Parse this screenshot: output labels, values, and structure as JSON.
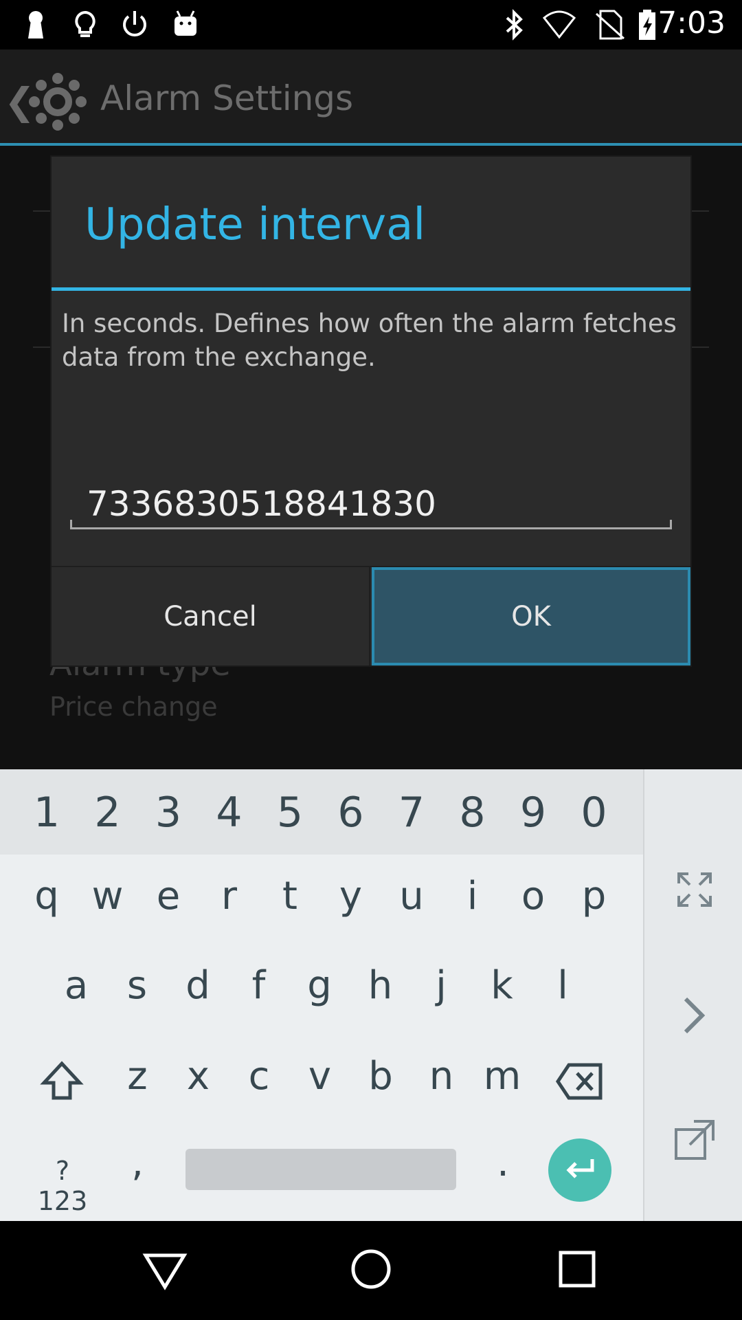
{
  "status_bar": {
    "time": "7:03",
    "left_icons": [
      "keyhole-icon",
      "lightbulb-icon",
      "power-icon",
      "android-icon"
    ],
    "right_icons": [
      "bluetooth-icon",
      "wifi-off-icon",
      "no-sim-icon",
      "battery-charging-icon"
    ]
  },
  "app_bar": {
    "title": "Alarm Settings"
  },
  "background_prefs": {
    "alarm_type_title": "Alarm type",
    "alarm_type_summary": "Price change"
  },
  "dialog": {
    "title": "Update interval",
    "message": "In seconds. Defines how often the alarm fetches data from the exchange.",
    "input_value": "7336830518841830",
    "cancel_label": "Cancel",
    "ok_label": "OK"
  },
  "keyboard": {
    "number_row": [
      "1",
      "2",
      "3",
      "4",
      "5",
      "6",
      "7",
      "8",
      "9",
      "0"
    ],
    "row1": [
      "q",
      "w",
      "e",
      "r",
      "t",
      "y",
      "u",
      "i",
      "o",
      "p"
    ],
    "row2": [
      "a",
      "s",
      "d",
      "f",
      "g",
      "h",
      "j",
      "k",
      "l"
    ],
    "row3": [
      "z",
      "x",
      "c",
      "v",
      "b",
      "n",
      "m"
    ],
    "symbols_label": "?123",
    "comma": ",",
    "period": ".",
    "side_icons": [
      "expand-icon",
      "chevron-right-icon",
      "popout-icon"
    ],
    "enter_color": "#4bbfb2"
  },
  "nav_bar": {
    "icons": [
      "back-triangle-icon",
      "home-circle-icon",
      "recents-square-icon"
    ]
  },
  "colors": {
    "accent": "#33b5e5",
    "ok_button": "#2e5466"
  }
}
